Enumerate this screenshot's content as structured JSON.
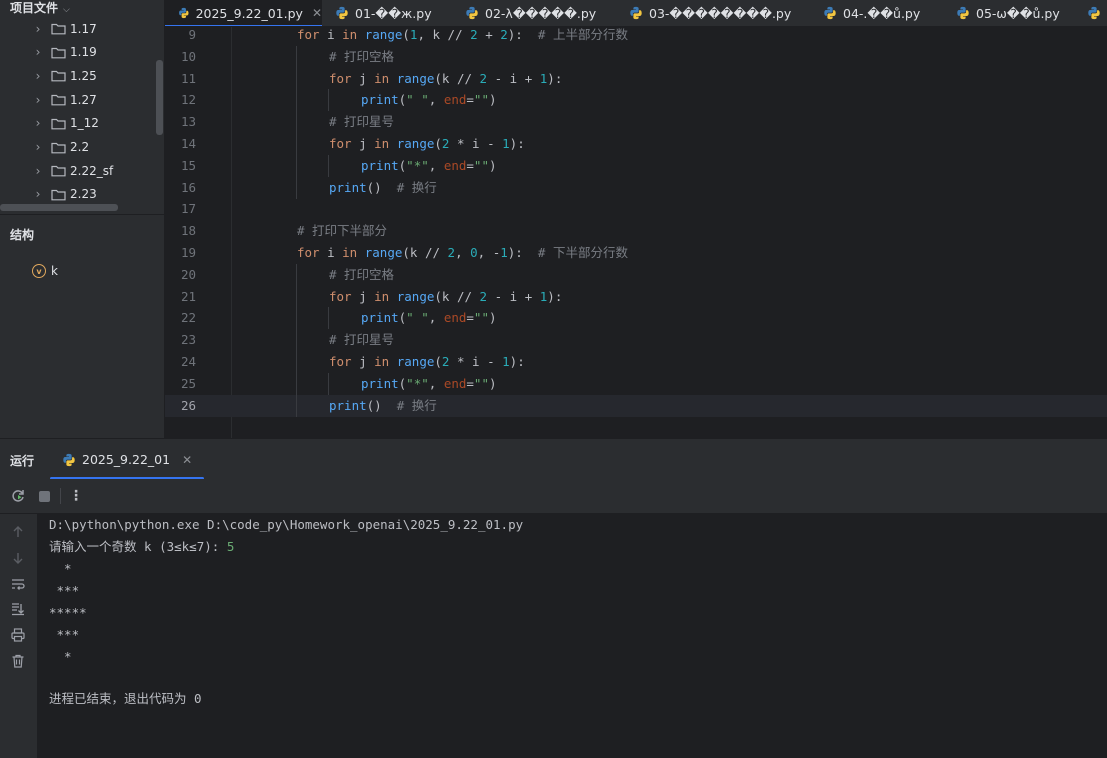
{
  "project_panel": {
    "title": "项目文件",
    "folders": [
      "1.17",
      "1.19",
      "1.25",
      "1.27",
      "1_12",
      "2.2",
      "2.22_sf",
      "2.23"
    ]
  },
  "structure": {
    "title": "结构",
    "items": [
      {
        "badge": "v",
        "name": "k"
      }
    ]
  },
  "tabs": [
    {
      "label": "2025_9.22_01.py",
      "active": true,
      "closable": true
    },
    {
      "label": "01-��ж.py",
      "active": false
    },
    {
      "label": "02-λ�����.py",
      "active": false
    },
    {
      "label": "03-��������.py",
      "active": false
    },
    {
      "label": "04-.��ů.py",
      "active": false
    },
    {
      "label": "05-ѡ��ů.py",
      "active": false
    }
  ],
  "editor": {
    "current_line": "26",
    "lines": [
      {
        "n": "9",
        "indent": 1,
        "tokens": [
          [
            "kw",
            "for"
          ],
          [
            "pl",
            " i "
          ],
          [
            "kw",
            "in"
          ],
          [
            "pl",
            " "
          ],
          [
            "fn",
            "range"
          ],
          [
            "pl",
            "("
          ],
          [
            "num",
            "1"
          ],
          [
            "pl",
            ", k // "
          ],
          [
            "num",
            "2"
          ],
          [
            "pl",
            " + "
          ],
          [
            "num",
            "2"
          ],
          [
            "pl",
            "):  "
          ],
          [
            "cmt",
            "# 上半部分行数"
          ]
        ]
      },
      {
        "n": "10",
        "indent": 2,
        "tokens": [
          [
            "cmt",
            "# 打印空格"
          ]
        ]
      },
      {
        "n": "11",
        "indent": 2,
        "tokens": [
          [
            "kw",
            "for"
          ],
          [
            "pl",
            " j "
          ],
          [
            "kw",
            "in"
          ],
          [
            "pl",
            " "
          ],
          [
            "fn",
            "range"
          ],
          [
            "pl",
            "(k // "
          ],
          [
            "num",
            "2"
          ],
          [
            "pl",
            " - i + "
          ],
          [
            "num",
            "1"
          ],
          [
            "pl",
            "):"
          ]
        ]
      },
      {
        "n": "12",
        "indent": 3,
        "tokens": [
          [
            "fn",
            "print"
          ],
          [
            "pl",
            "("
          ],
          [
            "str",
            "\" \""
          ],
          [
            "pl",
            ", "
          ],
          [
            "prm",
            "end"
          ],
          [
            "pl",
            "="
          ],
          [
            "str",
            "\"\""
          ],
          [
            "pl",
            ")"
          ]
        ]
      },
      {
        "n": "13",
        "indent": 2,
        "tokens": [
          [
            "cmt",
            "# 打印星号"
          ]
        ]
      },
      {
        "n": "14",
        "indent": 2,
        "tokens": [
          [
            "kw",
            "for"
          ],
          [
            "pl",
            " j "
          ],
          [
            "kw",
            "in"
          ],
          [
            "pl",
            " "
          ],
          [
            "fn",
            "range"
          ],
          [
            "pl",
            "("
          ],
          [
            "num",
            "2"
          ],
          [
            "pl",
            " * i - "
          ],
          [
            "num",
            "1"
          ],
          [
            "pl",
            "):"
          ]
        ]
      },
      {
        "n": "15",
        "indent": 3,
        "tokens": [
          [
            "fn",
            "print"
          ],
          [
            "pl",
            "("
          ],
          [
            "str",
            "\"*\""
          ],
          [
            "pl",
            ", "
          ],
          [
            "prm",
            "end"
          ],
          [
            "pl",
            "="
          ],
          [
            "str",
            "\"\""
          ],
          [
            "pl",
            ")"
          ]
        ]
      },
      {
        "n": "16",
        "indent": 2,
        "tokens": [
          [
            "fn",
            "print"
          ],
          [
            "pl",
            "()  "
          ],
          [
            "cmt",
            "# 换行"
          ]
        ]
      },
      {
        "n": "17",
        "indent": 0,
        "tokens": []
      },
      {
        "n": "18",
        "indent": 1,
        "tokens": [
          [
            "cmt",
            "# 打印下半部分"
          ]
        ]
      },
      {
        "n": "19",
        "indent": 1,
        "tokens": [
          [
            "kw",
            "for"
          ],
          [
            "pl",
            " i "
          ],
          [
            "kw",
            "in"
          ],
          [
            "pl",
            " "
          ],
          [
            "fn",
            "range"
          ],
          [
            "pl",
            "(k // "
          ],
          [
            "num",
            "2"
          ],
          [
            "pl",
            ", "
          ],
          [
            "num",
            "0"
          ],
          [
            "pl",
            ", -"
          ],
          [
            "num",
            "1"
          ],
          [
            "pl",
            "):  "
          ],
          [
            "cmt",
            "# 下半部分行数"
          ]
        ]
      },
      {
        "n": "20",
        "indent": 2,
        "tokens": [
          [
            "cmt",
            "# 打印空格"
          ]
        ]
      },
      {
        "n": "21",
        "indent": 2,
        "tokens": [
          [
            "kw",
            "for"
          ],
          [
            "pl",
            " j "
          ],
          [
            "kw",
            "in"
          ],
          [
            "pl",
            " "
          ],
          [
            "fn",
            "range"
          ],
          [
            "pl",
            "(k // "
          ],
          [
            "num",
            "2"
          ],
          [
            "pl",
            " - i + "
          ],
          [
            "num",
            "1"
          ],
          [
            "pl",
            "):"
          ]
        ]
      },
      {
        "n": "22",
        "indent": 3,
        "tokens": [
          [
            "fn",
            "print"
          ],
          [
            "pl",
            "("
          ],
          [
            "str",
            "\" \""
          ],
          [
            "pl",
            ", "
          ],
          [
            "prm",
            "end"
          ],
          [
            "pl",
            "="
          ],
          [
            "str",
            "\"\""
          ],
          [
            "pl",
            ")"
          ]
        ]
      },
      {
        "n": "23",
        "indent": 2,
        "tokens": [
          [
            "cmt",
            "# 打印星号"
          ]
        ]
      },
      {
        "n": "24",
        "indent": 2,
        "tokens": [
          [
            "kw",
            "for"
          ],
          [
            "pl",
            " j "
          ],
          [
            "kw",
            "in"
          ],
          [
            "pl",
            " "
          ],
          [
            "fn",
            "range"
          ],
          [
            "pl",
            "("
          ],
          [
            "num",
            "2"
          ],
          [
            "pl",
            " * i - "
          ],
          [
            "num",
            "1"
          ],
          [
            "pl",
            "):"
          ]
        ]
      },
      {
        "n": "25",
        "indent": 3,
        "tokens": [
          [
            "fn",
            "print"
          ],
          [
            "pl",
            "("
          ],
          [
            "str",
            "\"*\""
          ],
          [
            "pl",
            ", "
          ],
          [
            "prm",
            "end"
          ],
          [
            "pl",
            "="
          ],
          [
            "str",
            "\"\""
          ],
          [
            "pl",
            ")"
          ]
        ]
      },
      {
        "n": "26",
        "indent": 2,
        "tokens": [
          [
            "fn",
            "print"
          ],
          [
            "pl",
            "()  "
          ],
          [
            "cmt",
            "# 换行"
          ]
        ]
      }
    ]
  },
  "run_panel": {
    "title": "运行",
    "tab_label": "2025_9.22_01",
    "console": {
      "command": "D:\\python\\python.exe D:\\code_py\\Homework_openai\\2025_9.22_01.py",
      "prompt": "请输入一个奇数 k (3≤k≤7): ",
      "input_value": "5",
      "output_lines": [
        "  *",
        " ***",
        "*****",
        " ***",
        "  *",
        ""
      ],
      "exit_message": "进程已结束，退出代码为 0"
    }
  },
  "colors": {
    "background": "#1e1f22",
    "panel": "#2b2d30",
    "accent": "#3574f0",
    "keyword": "#cf8e6d",
    "function": "#56a8f5",
    "number": "#2aacb8",
    "string": "#6aab73",
    "comment": "#7a7e85"
  }
}
